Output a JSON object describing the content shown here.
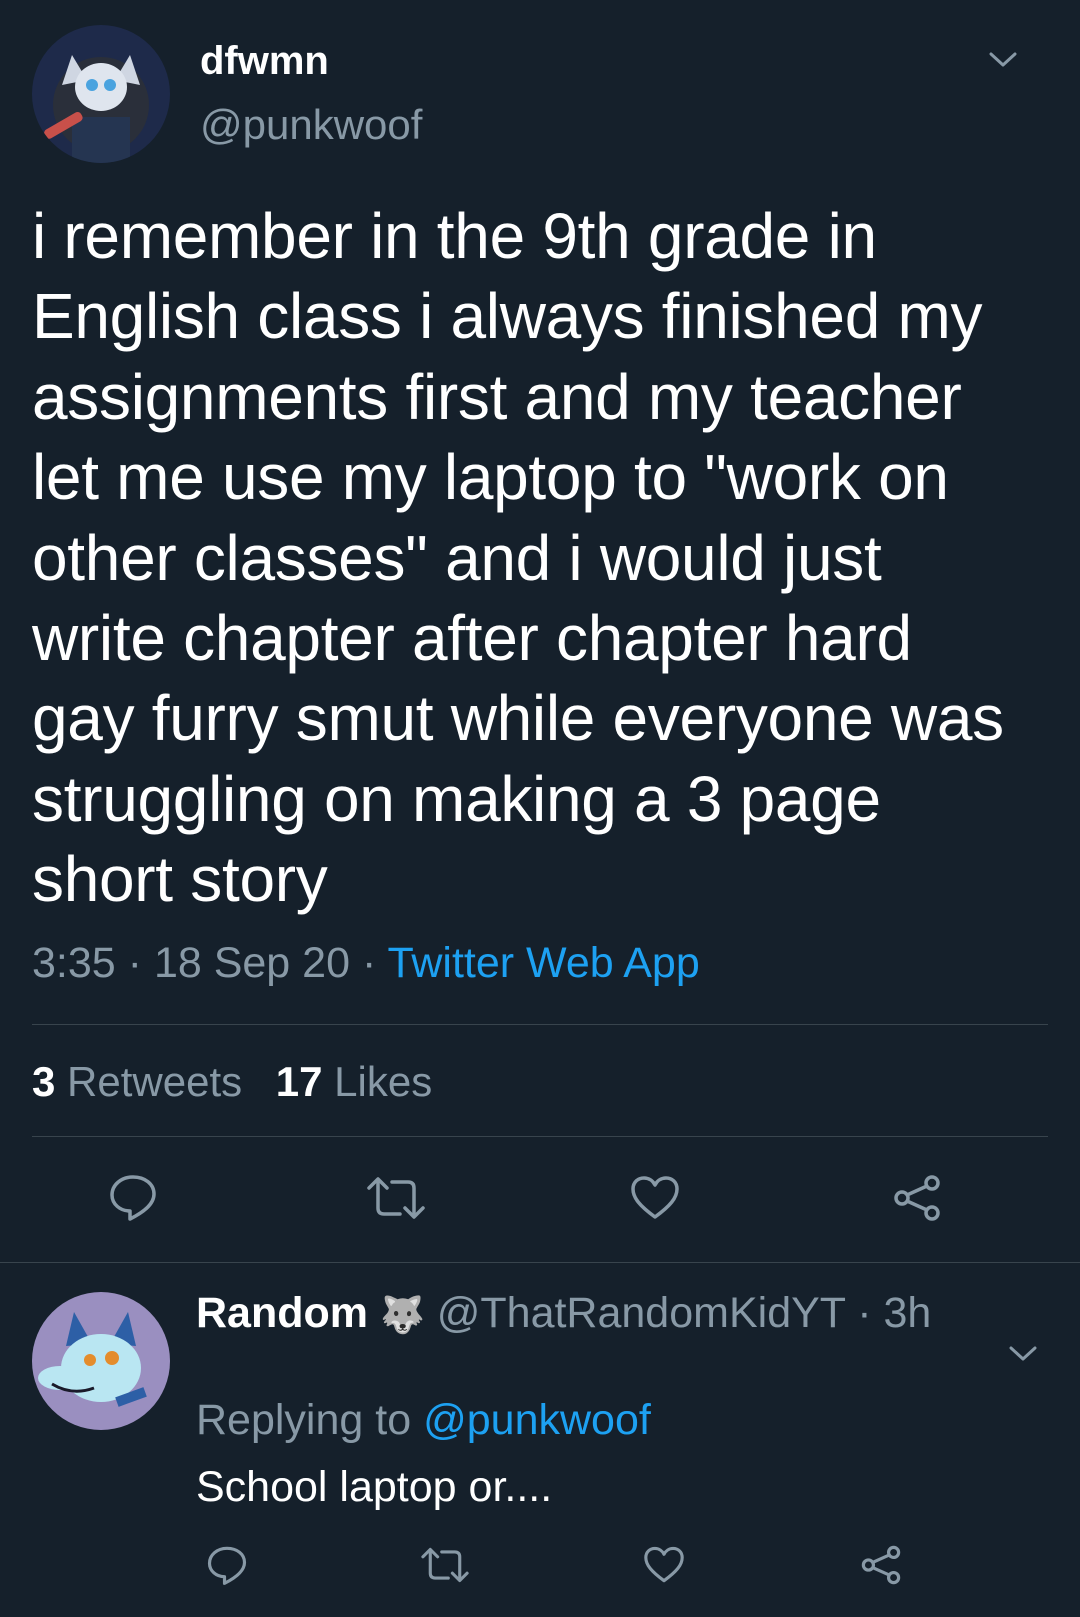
{
  "tweet": {
    "display_name": "dfwmn",
    "handle": "@punkwoof",
    "text_lines": [
      "i remember in the 9th grade in",
      "English class i always finished my",
      "assignments first and my teacher",
      "let me use my laptop to \"work on",
      "other classes\" and i would just",
      "write chapter after chapter hard",
      "gay furry smut while everyone was",
      "struggling on making a 3 page",
      "short story"
    ],
    "time": "3:35",
    "date": "18 Sep 20",
    "separator": "·",
    "source": "Twitter Web App",
    "retweet_count": "3",
    "retweet_label": "Retweets",
    "like_count": "17",
    "like_label": "Likes",
    "icons": [
      "chevron-down-icon",
      "reply-icon",
      "retweet-icon",
      "like-icon",
      "share-icon"
    ]
  },
  "reply": {
    "display_name": "Random",
    "badge": "🐺",
    "handle": "@ThatRandomKidYT",
    "separator": "·",
    "age": "3h",
    "replying_label": "Replying to",
    "replying_handle": "@punkwoof",
    "text": "School laptop or...."
  },
  "colors": {
    "background": "#15202b",
    "text": "#ffffff",
    "muted": "#8899a6",
    "accent": "#1da1f2",
    "divider": "#38444d"
  }
}
